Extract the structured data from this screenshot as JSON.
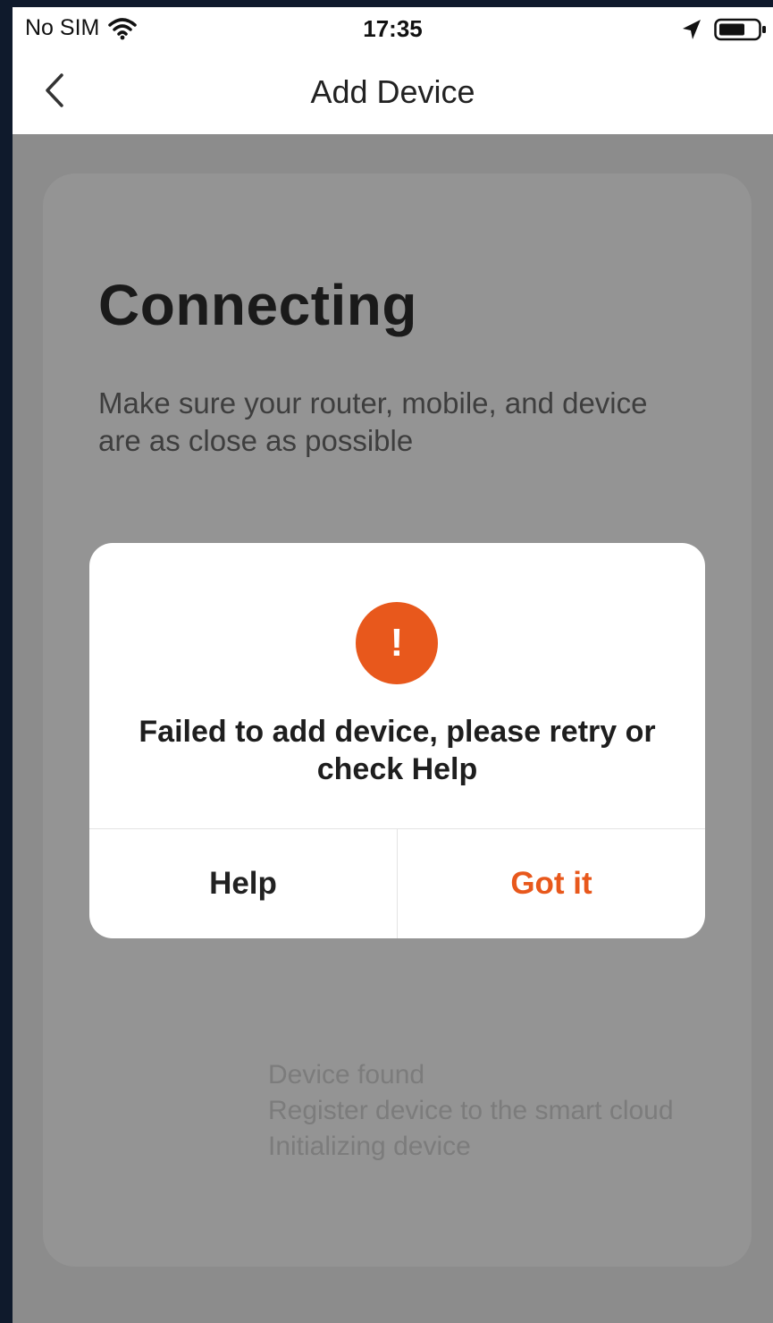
{
  "status_bar": {
    "carrier": "No SIM",
    "time": "17:35",
    "icons": [
      "wifi-icon",
      "location-arrow-icon",
      "battery-icon"
    ]
  },
  "nav": {
    "back_icon": "chevron-left-icon",
    "title": "Add Device"
  },
  "content": {
    "heading": "Connecting",
    "subtitle": "Make sure your router, mobile, and device are as close as possible",
    "steps": [
      "Device found",
      "Register device to the smart cloud",
      "Initializing device"
    ]
  },
  "dialog": {
    "icon": "exclamation-circle-icon",
    "icon_glyph": "!",
    "message": "Failed to add device, please retry or check Help",
    "help_label": "Help",
    "gotit_label": "Got it"
  },
  "colors": {
    "accent": "#e8581c",
    "overlay": "#8c8c8c",
    "card": "#949494"
  }
}
